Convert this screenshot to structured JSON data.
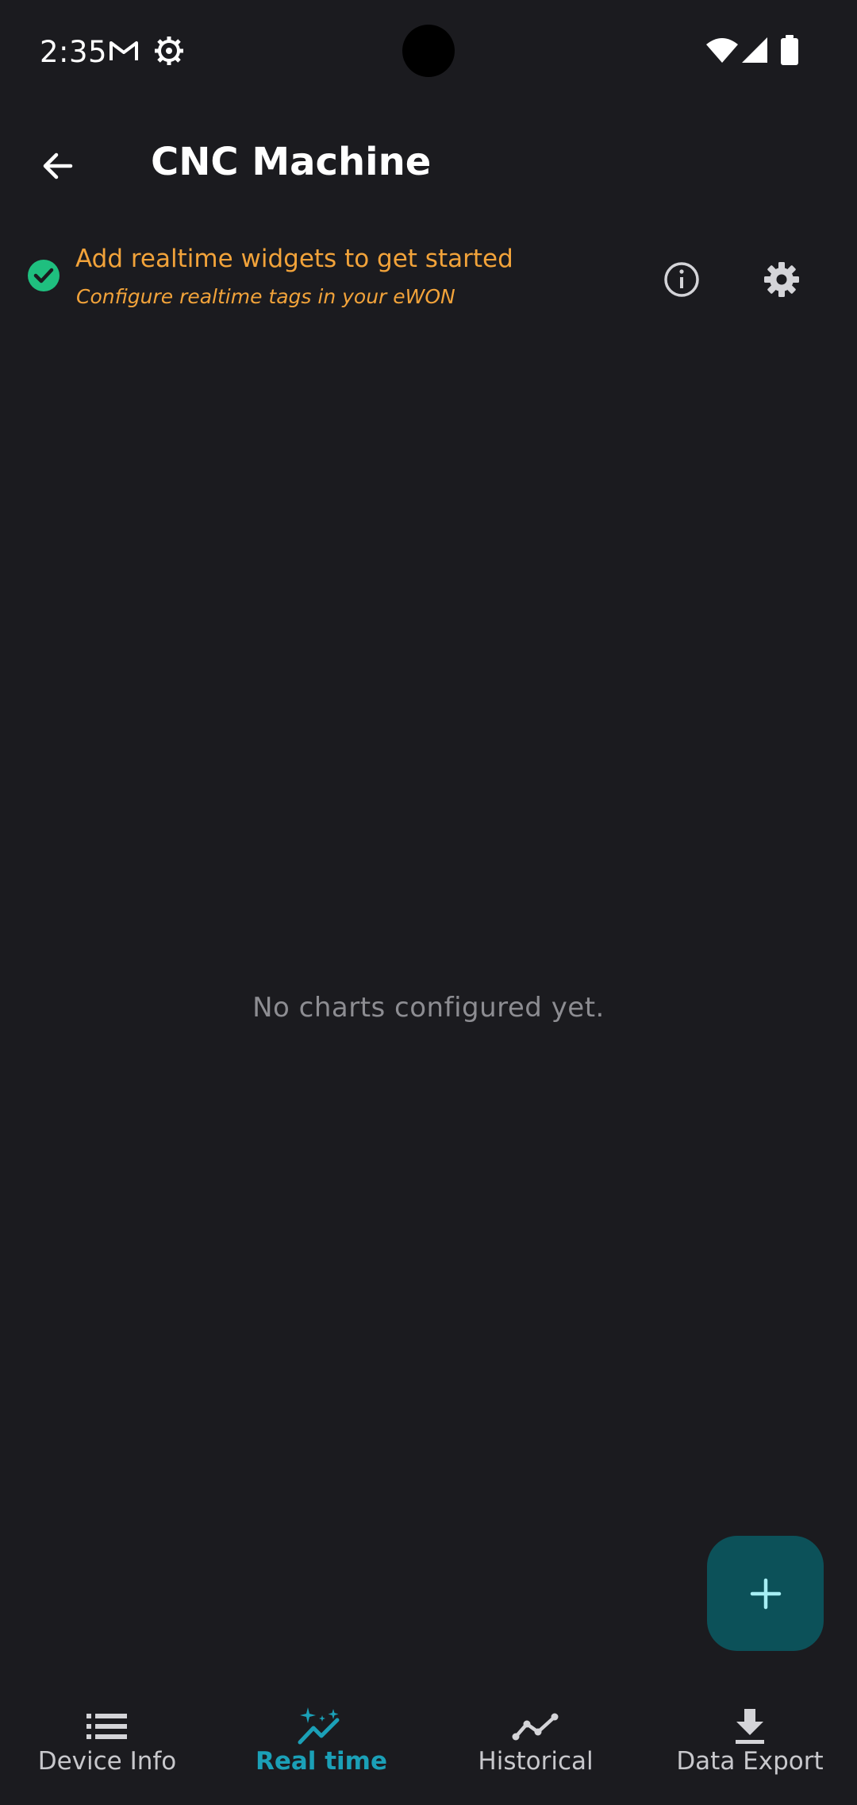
{
  "status_bar": {
    "time": "2:35"
  },
  "app_bar": {
    "title": "CNC Machine",
    "back_icon": "arrow-back-icon"
  },
  "banner": {
    "title": "Add realtime widgets to get started",
    "subtitle": "Configure realtime tags in your eWON",
    "status_icon": "check-circle-icon",
    "colors": {
      "text": "#f2a33a",
      "check": "#1fbf7f"
    }
  },
  "main": {
    "empty_message": "No charts configured yet."
  },
  "fab": {
    "icon": "plus-icon",
    "color": "#0c5159"
  },
  "bottom_nav": {
    "items": [
      {
        "label": "Device Info",
        "icon": "list-icon",
        "active": false
      },
      {
        "label": "Real time",
        "icon": "sparkle-chart-icon",
        "active": true
      },
      {
        "label": "Historical",
        "icon": "line-chart-icon",
        "active": false
      },
      {
        "label": "Data Export",
        "icon": "download-icon",
        "active": false
      }
    ],
    "active_color": "#1ba0b7"
  }
}
